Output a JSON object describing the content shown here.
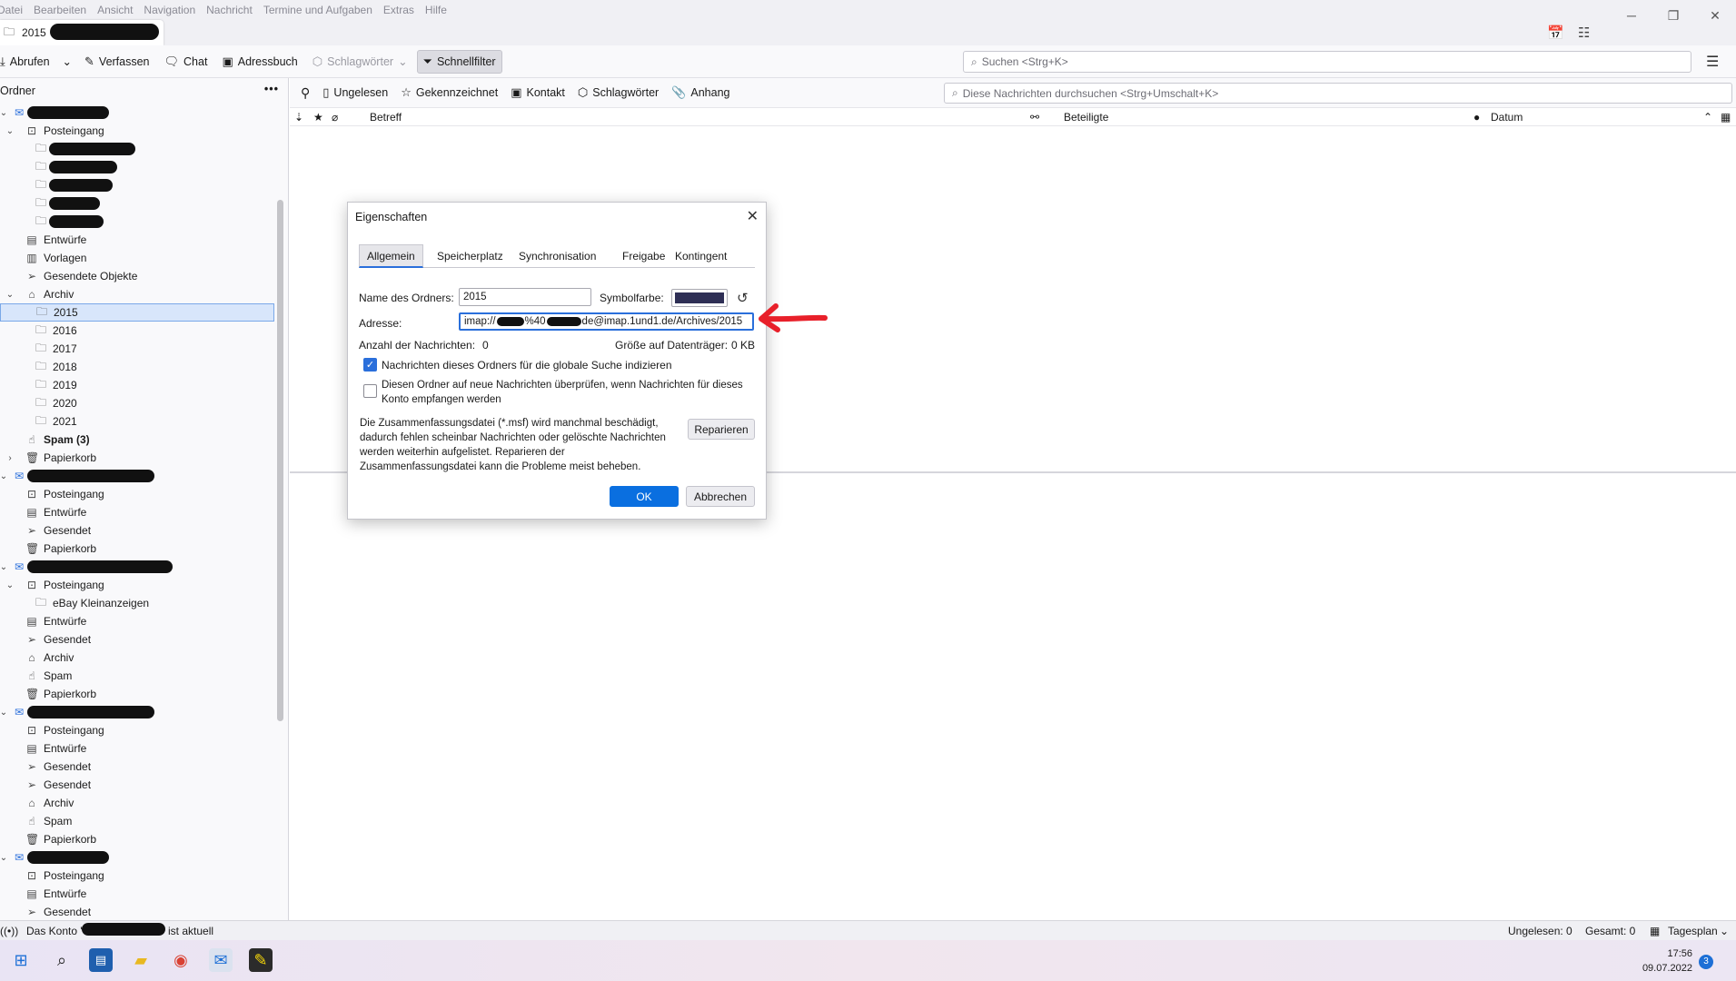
{
  "menubar": {
    "items": [
      "Datei",
      "Bearbeiten",
      "Ansicht",
      "Navigation",
      "Nachricht",
      "Termine und Aufgaben",
      "Extras",
      "Hilfe"
    ]
  },
  "window": {
    "minimize_icon": "minimize-icon",
    "maximize_icon": "restore-icon",
    "close_icon": "close-icon"
  },
  "tabs": [
    {
      "label": "2015"
    }
  ],
  "toolbar": {
    "get_label": "Abrufen",
    "compose_label": "Verfassen",
    "chat_label": "Chat",
    "addressbook_label": "Adressbuch",
    "tags_label": "Schlagwörter",
    "quickfilter_label": "Schnellfilter",
    "search_placeholder": "Suchen <Strg+K>"
  },
  "folderpane": {
    "header": "Ordner",
    "folders": [
      {
        "label": "",
        "level": 0,
        "icon": "mail-account-icon",
        "twisty": "expanded",
        "redacted": true
      },
      {
        "label": "Posteingang",
        "level": 1,
        "icon": "inbox-icon",
        "twisty": "expanded"
      },
      {
        "label": "",
        "level": 2,
        "icon": "folder-icon",
        "redacted": true
      },
      {
        "label": "",
        "level": 2,
        "icon": "folder-icon",
        "redacted": true
      },
      {
        "label": "",
        "level": 2,
        "icon": "folder-icon",
        "redacted": true
      },
      {
        "label": "",
        "level": 2,
        "icon": "folder-icon",
        "redacted": true
      },
      {
        "label": "",
        "level": 2,
        "icon": "folder-icon",
        "redacted": true
      },
      {
        "label": "Entwürfe",
        "level": 1,
        "icon": "drafts-icon"
      },
      {
        "label": "Vorlagen",
        "level": 1,
        "icon": "templates-icon"
      },
      {
        "label": "Gesendete Objekte",
        "level": 1,
        "icon": "sent-icon"
      },
      {
        "label": "Archiv",
        "level": 1,
        "icon": "archive-icon",
        "twisty": "expanded"
      },
      {
        "label": "2015",
        "level": 2,
        "icon": "folder-icon",
        "selected": true
      },
      {
        "label": "2016",
        "level": 2,
        "icon": "folder-icon"
      },
      {
        "label": "2017",
        "level": 2,
        "icon": "folder-icon"
      },
      {
        "label": "2018",
        "level": 2,
        "icon": "folder-icon"
      },
      {
        "label": "2019",
        "level": 2,
        "icon": "folder-icon"
      },
      {
        "label": "2020",
        "level": 2,
        "icon": "folder-icon"
      },
      {
        "label": "2021",
        "level": 2,
        "icon": "folder-icon"
      },
      {
        "label": "Spam (3)",
        "level": 1,
        "icon": "spam-icon",
        "bold": true
      },
      {
        "label": "Papierkorb",
        "level": 1,
        "icon": "trash-icon",
        "twisty": "collapsed"
      },
      {
        "label": "",
        "level": 0,
        "icon": "mail-account-icon",
        "twisty": "expanded",
        "redacted": true
      },
      {
        "label": "Posteingang",
        "level": 1,
        "icon": "inbox-icon"
      },
      {
        "label": "Entwürfe",
        "level": 1,
        "icon": "drafts-icon"
      },
      {
        "label": "Gesendet",
        "level": 1,
        "icon": "sent-icon"
      },
      {
        "label": "Papierkorb",
        "level": 1,
        "icon": "trash-icon"
      },
      {
        "label": "",
        "level": 0,
        "icon": "mail-account-icon",
        "twisty": "expanded",
        "redacted": true
      },
      {
        "label": "Posteingang",
        "level": 1,
        "icon": "inbox-icon",
        "twisty": "expanded"
      },
      {
        "label": "eBay Kleinanzeigen",
        "level": 2,
        "icon": "folder-icon"
      },
      {
        "label": "Entwürfe",
        "level": 1,
        "icon": "drafts-icon"
      },
      {
        "label": "Gesendet",
        "level": 1,
        "icon": "sent-icon"
      },
      {
        "label": "Archiv",
        "level": 1,
        "icon": "archive-icon"
      },
      {
        "label": "Spam",
        "level": 1,
        "icon": "spam-icon"
      },
      {
        "label": "Papierkorb",
        "level": 1,
        "icon": "trash-icon"
      },
      {
        "label": "",
        "level": 0,
        "icon": "mail-account-icon",
        "twisty": "expanded",
        "redacted": true
      },
      {
        "label": "Posteingang",
        "level": 1,
        "icon": "inbox-icon"
      },
      {
        "label": "Entwürfe",
        "level": 1,
        "icon": "drafts-icon"
      },
      {
        "label": "Gesendet",
        "level": 1,
        "icon": "sent-icon"
      },
      {
        "label": "Gesendet",
        "level": 1,
        "icon": "sent-icon"
      },
      {
        "label": "Archiv",
        "level": 1,
        "icon": "archive-icon"
      },
      {
        "label": "Spam",
        "level": 1,
        "icon": "spam-icon"
      },
      {
        "label": "Papierkorb",
        "level": 1,
        "icon": "trash-icon"
      },
      {
        "label": "",
        "level": 0,
        "icon": "mail-account-icon",
        "twisty": "expanded",
        "redacted": true
      },
      {
        "label": "Posteingang",
        "level": 1,
        "icon": "inbox-icon"
      },
      {
        "label": "Entwürfe",
        "level": 1,
        "icon": "drafts-icon"
      },
      {
        "label": "Gesendet",
        "level": 1,
        "icon": "sent-icon"
      }
    ]
  },
  "quickfilter": {
    "unread": "Ungelesen",
    "starred": "Gekennzeichnet",
    "contact": "Kontakt",
    "tags": "Schlagwörter",
    "attachment": "Anhang",
    "search_placeholder": "Diese Nachrichten durchsuchen <Strg+Umschalt+K>"
  },
  "threadpane": {
    "col_subject": "Betreff",
    "col_correspondents": "Beteiligte",
    "col_date": "Datum"
  },
  "dialog": {
    "title": "Eigenschaften",
    "tabs": [
      "Allgemein",
      "Speicherplatz",
      "Synchronisation",
      "Freigabe",
      "Kontingent"
    ],
    "name_label": "Name des Ordners:",
    "name_value": "2015",
    "color_label": "Symbolfarbe:",
    "icon_color": "#2e2f55",
    "address_label": "Adresse:",
    "address_value_prefix": "imap://",
    "address_value_mid": "%40",
    "address_value_suffix": "de@imap.1und1.de/Archives/2015",
    "count_label": "Anzahl der Nachrichten:",
    "count_value": "0",
    "size_label": "Größe auf Datenträger:",
    "size_value": "0 KB",
    "index_label": "Nachrichten dieses Ordners für die globale Suche indizieren",
    "index_checked": true,
    "check_label": "Diesen Ordner auf neue Nachrichten überprüfen, wenn Nachrichten für dieses Konto empfangen werden",
    "check_checked": false,
    "repair_text": "Die Zusammenfassungsdatei (*.msf) wird manchmal beschädigt, dadurch fehlen scheinbar Nachrichten oder gelöschte Nachrichten werden weiterhin aufgelistet. Reparieren der Zusammenfassungsdatei kann die Probleme meist beheben.",
    "repair_button": "Reparieren",
    "ok_button": "OK",
    "cancel_button": "Abbrechen",
    "primary_color": "#0a6fe0"
  },
  "statusbar": {
    "account_prefix": "Das Konto \"",
    "account_suffix": "ist aktuell",
    "unread": "Ungelesen: 0",
    "total": "Gesamt: 0",
    "today_pane": "Tagesplan"
  },
  "taskbar": {
    "time": "17:56",
    "date": "09.07.2022",
    "notification_count": "3"
  },
  "annotation": {
    "arrow_color": "#e8202a"
  }
}
